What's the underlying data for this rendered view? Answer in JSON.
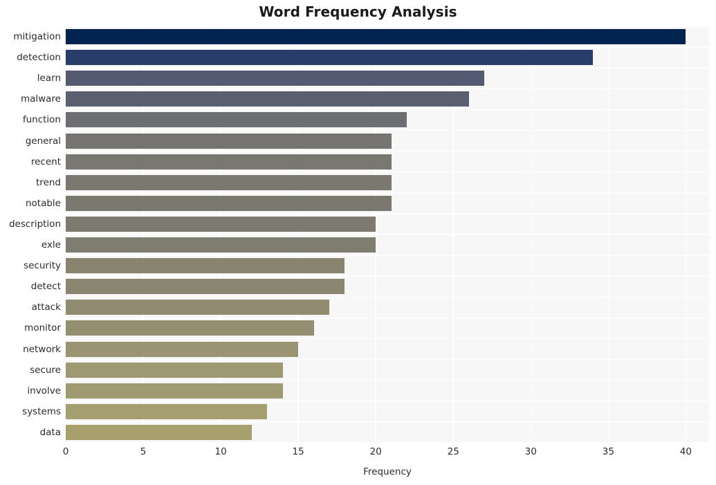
{
  "chart_data": {
    "type": "bar",
    "orientation": "horizontal",
    "title": "Word Frequency Analysis",
    "xlabel": "Frequency",
    "ylabel": "",
    "xlim": [
      0,
      41.5
    ],
    "xticks": [
      0,
      5,
      10,
      15,
      20,
      25,
      30,
      35,
      40
    ],
    "grid": true,
    "legend": null,
    "categories": [
      "mitigation",
      "detection",
      "learn",
      "malware",
      "function",
      "general",
      "recent",
      "trend",
      "notable",
      "description",
      "exle",
      "security",
      "detect",
      "attack",
      "monitor",
      "network",
      "secure",
      "involve",
      "systems",
      "data"
    ],
    "values": [
      40,
      34,
      27,
      26,
      22,
      21,
      21,
      21,
      21,
      20,
      20,
      18,
      18,
      17,
      16,
      15,
      14,
      14,
      13,
      12
    ],
    "bar_colors": [
      "#00234f",
      "#293d6b",
      "#545a72",
      "#5b6070",
      "#6d6e71",
      "#757470",
      "#787770",
      "#7a786f",
      "#7a786f",
      "#7d7b70",
      "#7f7c70",
      "#888470",
      "#8a8671",
      "#908b71",
      "#948f71",
      "#9a9472",
      "#9e9873",
      "#a09a73",
      "#a59e6e",
      "#a8a06c"
    ]
  },
  "axes": {
    "plot_background": "#f7f7f7",
    "gridline_color": "#ffffff",
    "tick_text_color": "#2b2b2b"
  }
}
